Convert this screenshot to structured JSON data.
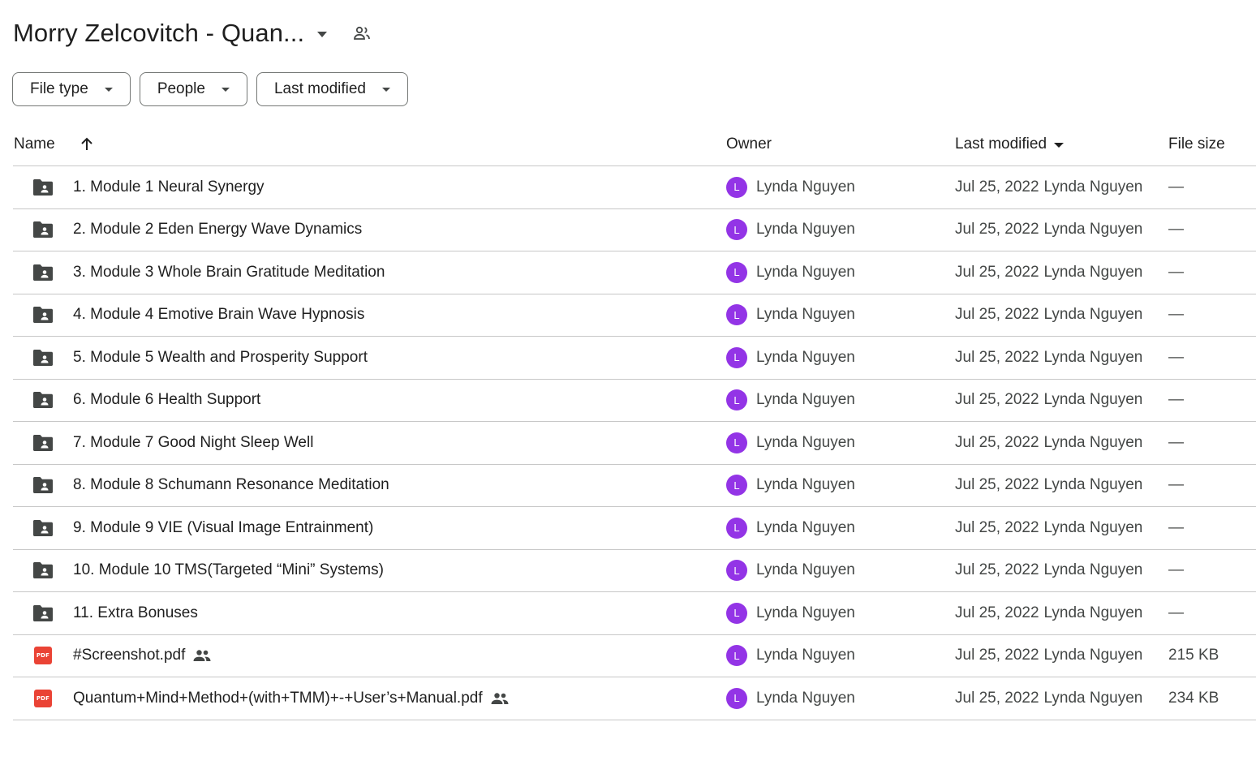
{
  "header": {
    "title": "Morry Zelcovitch - Quan..."
  },
  "filters": [
    {
      "label": "File type"
    },
    {
      "label": "People"
    },
    {
      "label": "Last modified"
    }
  ],
  "columns": {
    "name": "Name",
    "owner": "Owner",
    "last_modified": "Last modified",
    "file_size": "File size"
  },
  "rows": [
    {
      "type": "folder",
      "name": "1. Module 1 Neural Synergy",
      "owner_initial": "L",
      "owner": "Lynda Nguyen",
      "modified_date": "Jul 25, 2022",
      "modified_by": "Lynda Nguyen",
      "size": "—",
      "shared": false
    },
    {
      "type": "folder",
      "name": "2. Module 2 Eden Energy Wave Dynamics",
      "owner_initial": "L",
      "owner": "Lynda Nguyen",
      "modified_date": "Jul 25, 2022",
      "modified_by": "Lynda Nguyen",
      "size": "—",
      "shared": false
    },
    {
      "type": "folder",
      "name": "3. Module 3 Whole Brain Gratitude Meditation",
      "owner_initial": "L",
      "owner": "Lynda Nguyen",
      "modified_date": "Jul 25, 2022",
      "modified_by": "Lynda Nguyen",
      "size": "—",
      "shared": false
    },
    {
      "type": "folder",
      "name": "4. Module 4 Emotive Brain Wave Hypnosis",
      "owner_initial": "L",
      "owner": "Lynda Nguyen",
      "modified_date": "Jul 25, 2022",
      "modified_by": "Lynda Nguyen",
      "size": "—",
      "shared": false
    },
    {
      "type": "folder",
      "name": "5. Module 5 Wealth and Prosperity Support",
      "owner_initial": "L",
      "owner": "Lynda Nguyen",
      "modified_date": "Jul 25, 2022",
      "modified_by": "Lynda Nguyen",
      "size": "—",
      "shared": false
    },
    {
      "type": "folder",
      "name": "6. Module 6 Health Support",
      "owner_initial": "L",
      "owner": "Lynda Nguyen",
      "modified_date": "Jul 25, 2022",
      "modified_by": "Lynda Nguyen",
      "size": "—",
      "shared": false
    },
    {
      "type": "folder",
      "name": "7. Module 7 Good Night Sleep Well",
      "owner_initial": "L",
      "owner": "Lynda Nguyen",
      "modified_date": "Jul 25, 2022",
      "modified_by": "Lynda Nguyen",
      "size": "—",
      "shared": false
    },
    {
      "type": "folder",
      "name": "8. Module 8 Schumann Resonance Meditation",
      "owner_initial": "L",
      "owner": "Lynda Nguyen",
      "modified_date": "Jul 25, 2022",
      "modified_by": "Lynda Nguyen",
      "size": "—",
      "shared": false
    },
    {
      "type": "folder",
      "name": "9. Module 9 VIE (Visual Image Entrainment)",
      "owner_initial": "L",
      "owner": "Lynda Nguyen",
      "modified_date": "Jul 25, 2022",
      "modified_by": "Lynda Nguyen",
      "size": "—",
      "shared": false
    },
    {
      "type": "folder",
      "name": "10. Module 10 TMS(Targeted “Mini” Systems)",
      "owner_initial": "L",
      "owner": "Lynda Nguyen",
      "modified_date": "Jul 25, 2022",
      "modified_by": "Lynda Nguyen",
      "size": "—",
      "shared": false
    },
    {
      "type": "folder",
      "name": "11. Extra Bonuses",
      "owner_initial": "L",
      "owner": "Lynda Nguyen",
      "modified_date": "Jul 25, 2022",
      "modified_by": "Lynda Nguyen",
      "size": "—",
      "shared": false
    },
    {
      "type": "pdf",
      "name": "#Screenshot.pdf",
      "owner_initial": "L",
      "owner": "Lynda Nguyen",
      "modified_date": "Jul 25, 2022",
      "modified_by": "Lynda Nguyen",
      "size": "215 KB",
      "shared": true
    },
    {
      "type": "pdf",
      "name": "Quantum+Mind+Method+(with+TMM)+-+User’s+Manual.pdf",
      "owner_initial": "L",
      "owner": "Lynda Nguyen",
      "modified_date": "Jul 25, 2022",
      "modified_by": "Lynda Nguyen",
      "size": "234 KB",
      "shared": true
    }
  ],
  "pdf_badge_label": "PDF",
  "colors": {
    "avatar": "#9334e6",
    "pdf": "#ea4335",
    "folder": "#444746",
    "divider": "#c7c7c7"
  },
  "icons": {
    "folder": "shared-folder-icon",
    "pdf": "pdf-icon",
    "shared": "people-icon",
    "sort": "arrow-up-icon"
  }
}
